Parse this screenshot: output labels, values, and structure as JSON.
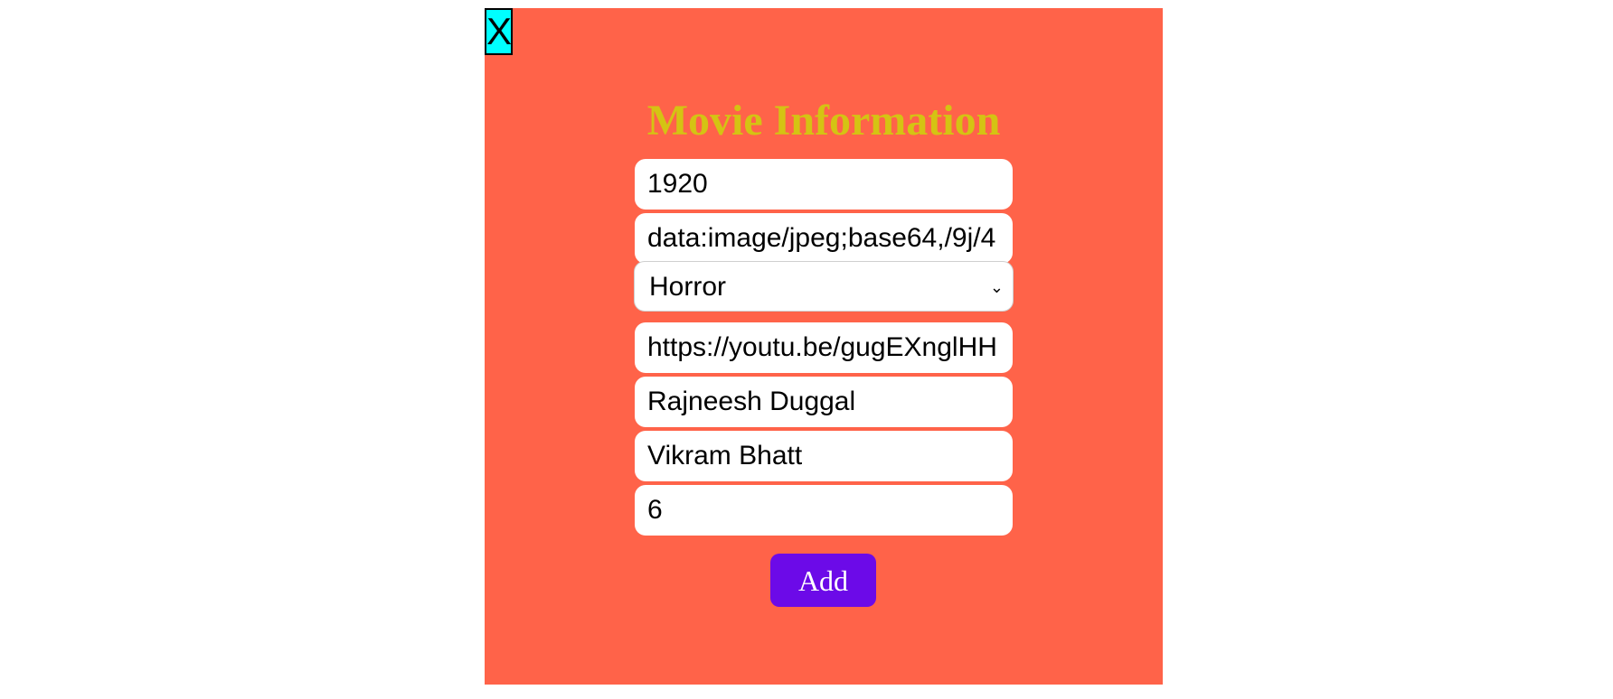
{
  "modal": {
    "close_label": "X",
    "title": "Movie Information",
    "fields": {
      "year": "1920",
      "image": "data:image/jpeg;base64,/9j/4",
      "genre": "Horror",
      "trailer": "https://youtu.be/gugEXnglHH",
      "actor": "Rajneesh Duggal",
      "director": "Vikram Bhatt",
      "rating": "6"
    },
    "add_label": "Add",
    "colors": {
      "modal_bg": "#ff6349",
      "title": "#d4c313",
      "close_bg": "#00ffff",
      "add_bg": "#6c0ae8"
    }
  }
}
